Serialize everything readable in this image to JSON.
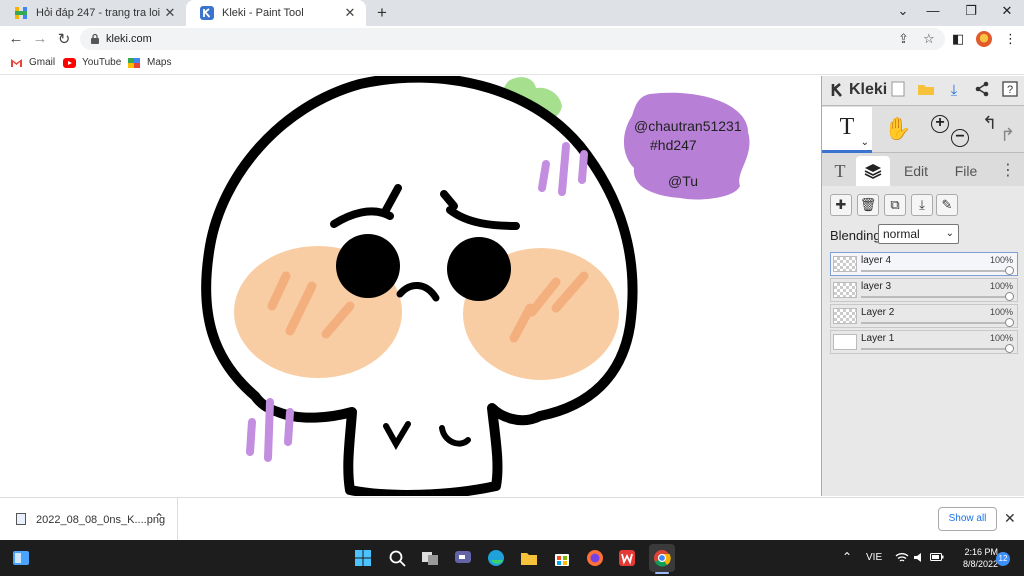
{
  "browser": {
    "tabs": [
      {
        "title": "Hỏi đáp 247 - trang tra loi",
        "icon": "hoidap-favicon",
        "active": false
      },
      {
        "title": "Kleki - Paint Tool",
        "icon": "kleki-favicon",
        "active": true
      }
    ],
    "url": "kleki.com",
    "bookmarks": [
      {
        "label": "Gmail",
        "icon": "gmail-icon"
      },
      {
        "label": "YouTube",
        "icon": "youtube-icon"
      },
      {
        "label": "Maps",
        "icon": "maps-icon"
      }
    ]
  },
  "canvas": {
    "bubble_lines": [
      "@chautran51231",
      "#hd247",
      "@Tu"
    ],
    "colors": {
      "outline": "#000000",
      "blush": "#f9cda3",
      "blush_marks": "#f3b07e",
      "bubble": "#b77fd6",
      "sprout": "#a6e08f",
      "motion_marks": "#c38de0"
    }
  },
  "kleki": {
    "logo": "Kleki",
    "active_tool_glyph": "T",
    "tabs": [
      {
        "label": "T",
        "active": false
      },
      {
        "label": "layers-icon",
        "active": true
      },
      {
        "label": "Edit",
        "active": false
      },
      {
        "label": "File",
        "active": false
      }
    ],
    "blending_label": "Blending",
    "blending_value": "normal",
    "layers": [
      {
        "name": "layer 4",
        "opacity": "100%",
        "active": true
      },
      {
        "name": "layer 3",
        "opacity": "100%",
        "active": false
      },
      {
        "name": "Layer 2",
        "opacity": "100%",
        "active": false
      },
      {
        "name": "Layer 1",
        "opacity": "100%",
        "active": false
      }
    ]
  },
  "downloads": {
    "filename": "2022_08_08_0ns_K....png",
    "show_all": "Show all"
  },
  "taskbar": {
    "language": "VIE",
    "time": "2:16 PM",
    "date": "8/8/2022",
    "notifications": "12"
  }
}
